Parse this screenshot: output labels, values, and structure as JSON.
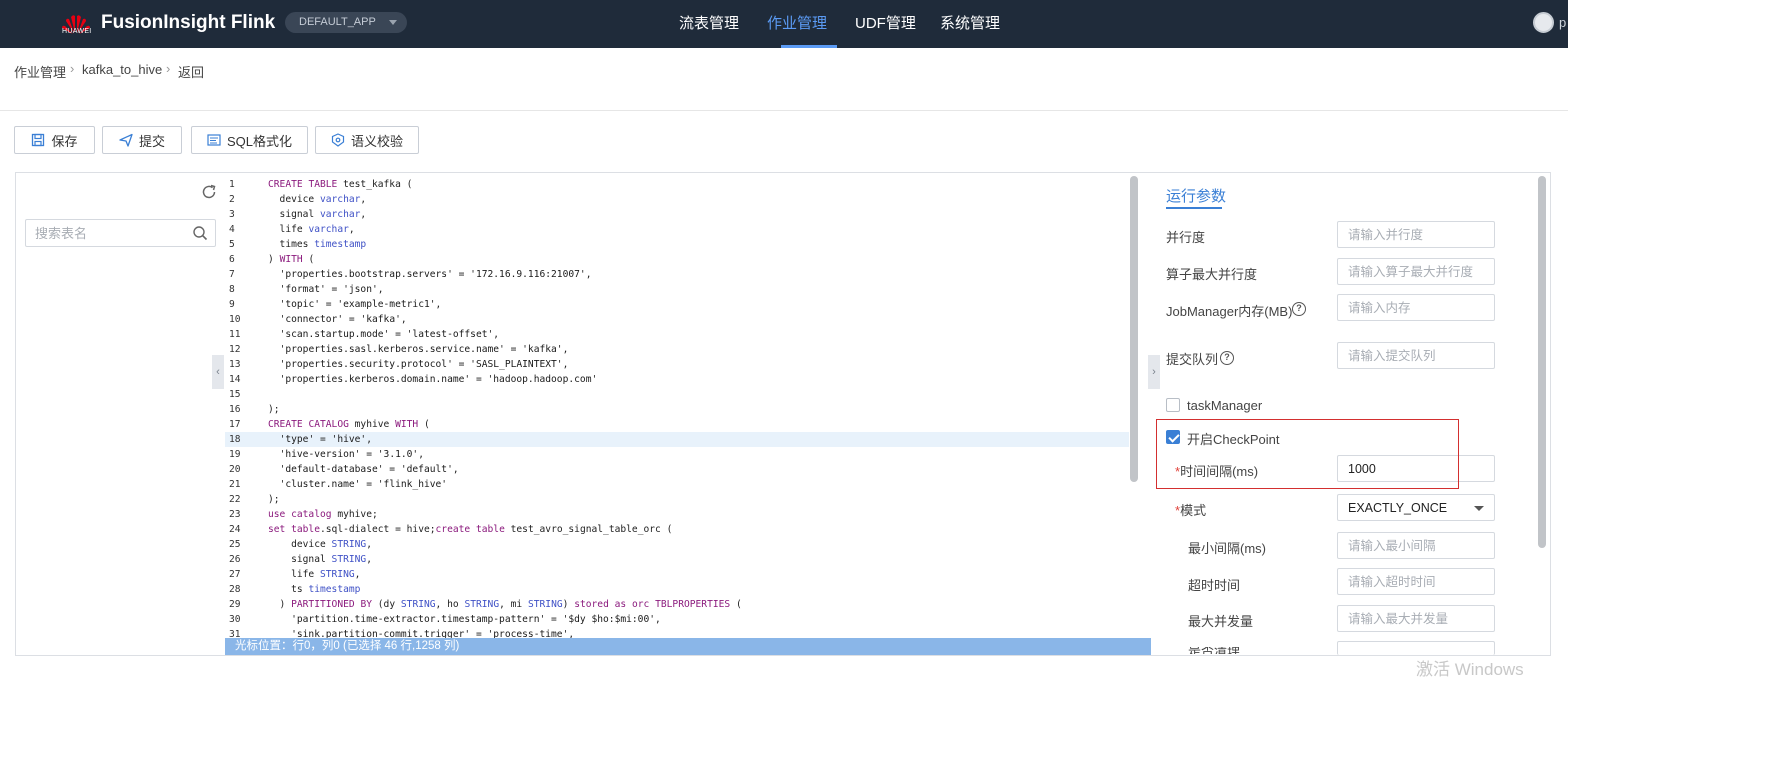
{
  "header": {
    "logo_text": "HUAWEI",
    "brand": "FusionInsight Flink",
    "app_selector": "DEFAULT_APP",
    "nav": [
      {
        "label": "流表管理",
        "active": false
      },
      {
        "label": "作业管理",
        "active": true
      },
      {
        "label": "UDF管理",
        "active": false
      },
      {
        "label": "系统管理",
        "active": false
      }
    ],
    "user_initial": "p"
  },
  "breadcrumb": [
    "作业管理",
    "kafka_to_hive",
    "返回"
  ],
  "toolbar": {
    "save": "保存",
    "submit": "提交",
    "format": "SQL格式化",
    "validate": "语义校验"
  },
  "left_panel": {
    "search_placeholder": "搜索表名"
  },
  "editor": {
    "current_line": 18,
    "lines": [
      "CREATE TABLE test_kafka (",
      "  device varchar,",
      "  signal varchar,",
      "  life varchar,",
      "  times timestamp",
      ") WITH (",
      "  'properties.bootstrap.servers' = '172.16.9.116:21007',",
      "  'format' = 'json',",
      "  'topic' = 'example-metric1',",
      "  'connector' = 'kafka',",
      "  'scan.startup.mode' = 'latest-offset',",
      "  'properties.sasl.kerberos.service.name' = 'kafka',",
      "  'properties.security.protocol' = 'SASL_PLAINTEXT',",
      "  'properties.kerberos.domain.name' = 'hadoop.hadoop.com'",
      "",
      ");",
      "CREATE CATALOG myhive WITH (",
      "  'type' = 'hive',",
      "  'hive-version' = '3.1.0',",
      "  'default-database' = 'default',",
      "  'cluster.name' = 'flink_hive'",
      ");",
      "use catalog myhive;",
      "set table.sql-dialect = hive;create table test_avro_signal_table_orc (",
      "    device STRING,",
      "    signal STRING,",
      "    life STRING,",
      "    ts timestamp",
      "  ) PARTITIONED BY (dy STRING, ho STRING, mi STRING) stored as orc TBLPROPERTIES (",
      "    'partition.time-extractor.timestamp-pattern' = '$dy $ho:$mi:00',",
      "    'sink.partition-commit.trigger' = 'process-time',"
    ],
    "status": "光标位置：行0，列0 (已选择 46 行,1258 列)"
  },
  "right_panel": {
    "tab": "运行参数",
    "fields": {
      "parallelism": {
        "label": "并行度",
        "placeholder": "请输入并行度"
      },
      "max_parallelism": {
        "label": "算子最大并行度",
        "placeholder": "请输入算子最大并行度"
      },
      "jm_memory": {
        "label": "JobManager内存(MB)",
        "placeholder": "请输入内存"
      },
      "queue": {
        "label": "提交队列",
        "placeholder": "请输入提交队列"
      }
    },
    "task_manager": {
      "label": "taskManager",
      "checked": false
    },
    "checkpoint": {
      "label": "开启CheckPoint",
      "checked": true
    },
    "interval": {
      "label": "时间间隔(ms)",
      "value": "1000"
    },
    "mode": {
      "label": "模式",
      "value": "EXACTLY_ONCE"
    },
    "min_interval": {
      "label": "最小间隔(ms)",
      "placeholder": "请输入最小间隔"
    },
    "timeout": {
      "label": "超时时间",
      "placeholder": "请输入超时时间"
    },
    "max_concurrent": {
      "label": "最大并发量",
      "placeholder": "请输入最大并发量"
    },
    "next_partial": "是否清理"
  },
  "watermark": "激活 Windows",
  "colors": {
    "accent": "#3a7fd5",
    "topbar": "#1f2b3a",
    "highlight": "#d32f2f"
  }
}
